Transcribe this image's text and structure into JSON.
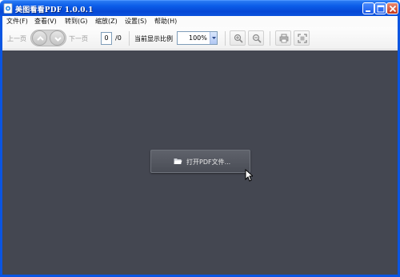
{
  "window": {
    "title": "美图看看PDF 1.0.0.1"
  },
  "menu": {
    "items": [
      "文件(F)",
      "查看(V)",
      "转到(G)",
      "缩放(Z)",
      "设置(S)",
      "帮助(H)"
    ]
  },
  "toolbar": {
    "prev_page": "上一页",
    "next_page": "下一页",
    "page_current": "0",
    "page_total": "/0",
    "zoom_label": "当前显示比例",
    "zoom_value": "100%",
    "icons": [
      "zoom-in-icon",
      "zoom-out-icon",
      "print-icon",
      "fullscreen-icon"
    ]
  },
  "main": {
    "open_button_label": "打开PDF文件..."
  },
  "colors": {
    "titlebar": "#0b5ce8",
    "canvas_background": "#444751",
    "open_button": "#55585f"
  }
}
